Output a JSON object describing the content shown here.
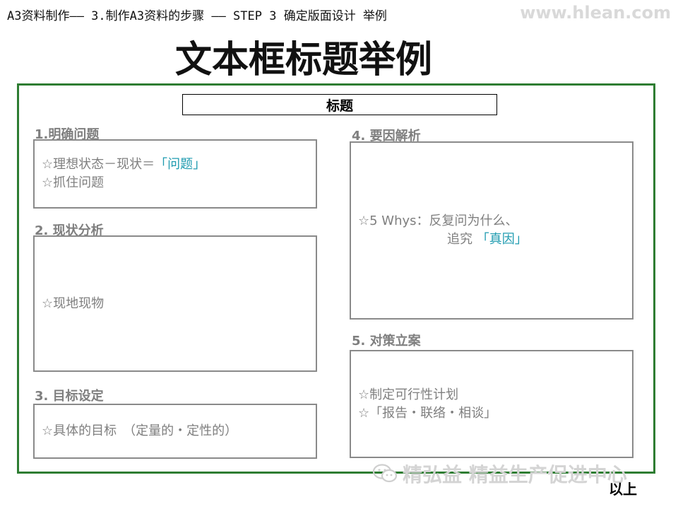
{
  "header": {
    "breadcrumb": "A3资料制作—— 3.制作A3资料的步骤 —— STEP 3 确定版面设计 举例",
    "watermark_url": "www.hlean.com",
    "title": "文本框标题举例"
  },
  "frame": {
    "header_label": "标题"
  },
  "sections": {
    "s1": {
      "label": "1.明确问题",
      "line1_text": "☆理想状态－现状＝",
      "line1_highlight": "「问题」",
      "line2": "☆抓住问题"
    },
    "s2": {
      "label": "2. 现状分析",
      "line1": "☆现地现物"
    },
    "s3": {
      "label": "3. 目标设定",
      "line1": "☆具体的目标　（定量的・定性的）"
    },
    "s4": {
      "label": "4. 要因解析",
      "line1": "☆5 Whys：反复问为什么、",
      "line2_text": "追究",
      "line2_highlight": "「真因」"
    },
    "s5": {
      "label": "5. 对策立案",
      "line1": "☆制定可行性计划",
      "line2": "☆「报告・联络・相谈」"
    }
  },
  "footer": {
    "watermark_wechat": "精弘益 精益生产促进中心",
    "end_mark": "以上"
  },
  "colors": {
    "frame_border": "#2e7d32",
    "label_gray": "#7f7f7f",
    "highlight": "#1f9bb0"
  }
}
